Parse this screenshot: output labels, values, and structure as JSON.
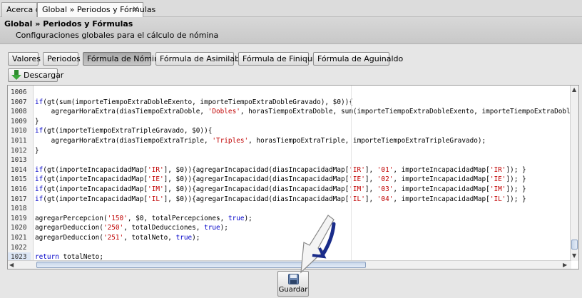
{
  "tabs": [
    {
      "label": "Acerca de"
    },
    {
      "label": "Global » Periodos y Fórmulas",
      "close": "✕"
    }
  ],
  "header": {
    "title": "Global » Periodos y Fórmulas",
    "subtitle": "Configuraciones globales para el cálculo de nómina"
  },
  "toolbar": {
    "buttons": [
      {
        "label": "Valores"
      },
      {
        "label": "Periodos"
      },
      {
        "label": "Fórmula de Nómina",
        "active": true
      },
      {
        "label": "Fórmula de Asimilables"
      },
      {
        "label": "Fórmula de Finiquito"
      },
      {
        "label": "Fórmula de Aguinaldo"
      }
    ],
    "download_label": "Descargar"
  },
  "editor": {
    "line_numbers": [
      "1006",
      "1007",
      "1008",
      "1009",
      "1010",
      "1011",
      "1012",
      "1013",
      "1014",
      "1015",
      "1016",
      "1017",
      "1018",
      "1019",
      "1020",
      "1021",
      "1022",
      "1023"
    ],
    "current_line": "1023",
    "lines": [
      "",
      "if(gt(sum(importeTiempoExtraDobleExento, importeTiempoExtraDobleGravado), $0)){",
      "    agregarHoraExtra(diasTiempoExtraDoble, 'Dobles', horasTiempoExtraDoble, sum(importeTiempoExtraDobleExento, importeTiempoExtraDobleG",
      "}",
      "if(gt(importeTiempoExtraTripleGravado, $0)){",
      "    agregarHoraExtra(diasTiempoExtraTriple, 'Triples', horasTiempoExtraTriple, importeTiempoExtraTripleGravado);",
      "}",
      "",
      "if(gt(importeIncapacidadMap['IR'], $0)){agregarIncapacidad(diasIncapacidadMap['IR'], '01', importeIncapacidadMap['IR']); }",
      "if(gt(importeIncapacidadMap['IE'], $0)){agregarIncapacidad(diasIncapacidadMap['IE'], '02', importeIncapacidadMap['IE']); }",
      "if(gt(importeIncapacidadMap['IM'], $0)){agregarIncapacidad(diasIncapacidadMap['IM'], '03', importeIncapacidadMap['IM']); }",
      "if(gt(importeIncapacidadMap['IL'], $0)){agregarIncapacidad(diasIncapacidadMap['IL'], '04', importeIncapacidadMap['IL']); }",
      "",
      "agregarPercepcion('150', $0, totalPercepciones, true);",
      "agregarDeduccion('250', totalDeducciones, true);",
      "agregarDeduccion('251', totalNeto, true);",
      "",
      "return totalNeto;"
    ]
  },
  "save_label": "Guardar",
  "colors": {
    "keyword": "#0000c8",
    "string": "#c00000",
    "active_button": "#b4b4b4"
  }
}
